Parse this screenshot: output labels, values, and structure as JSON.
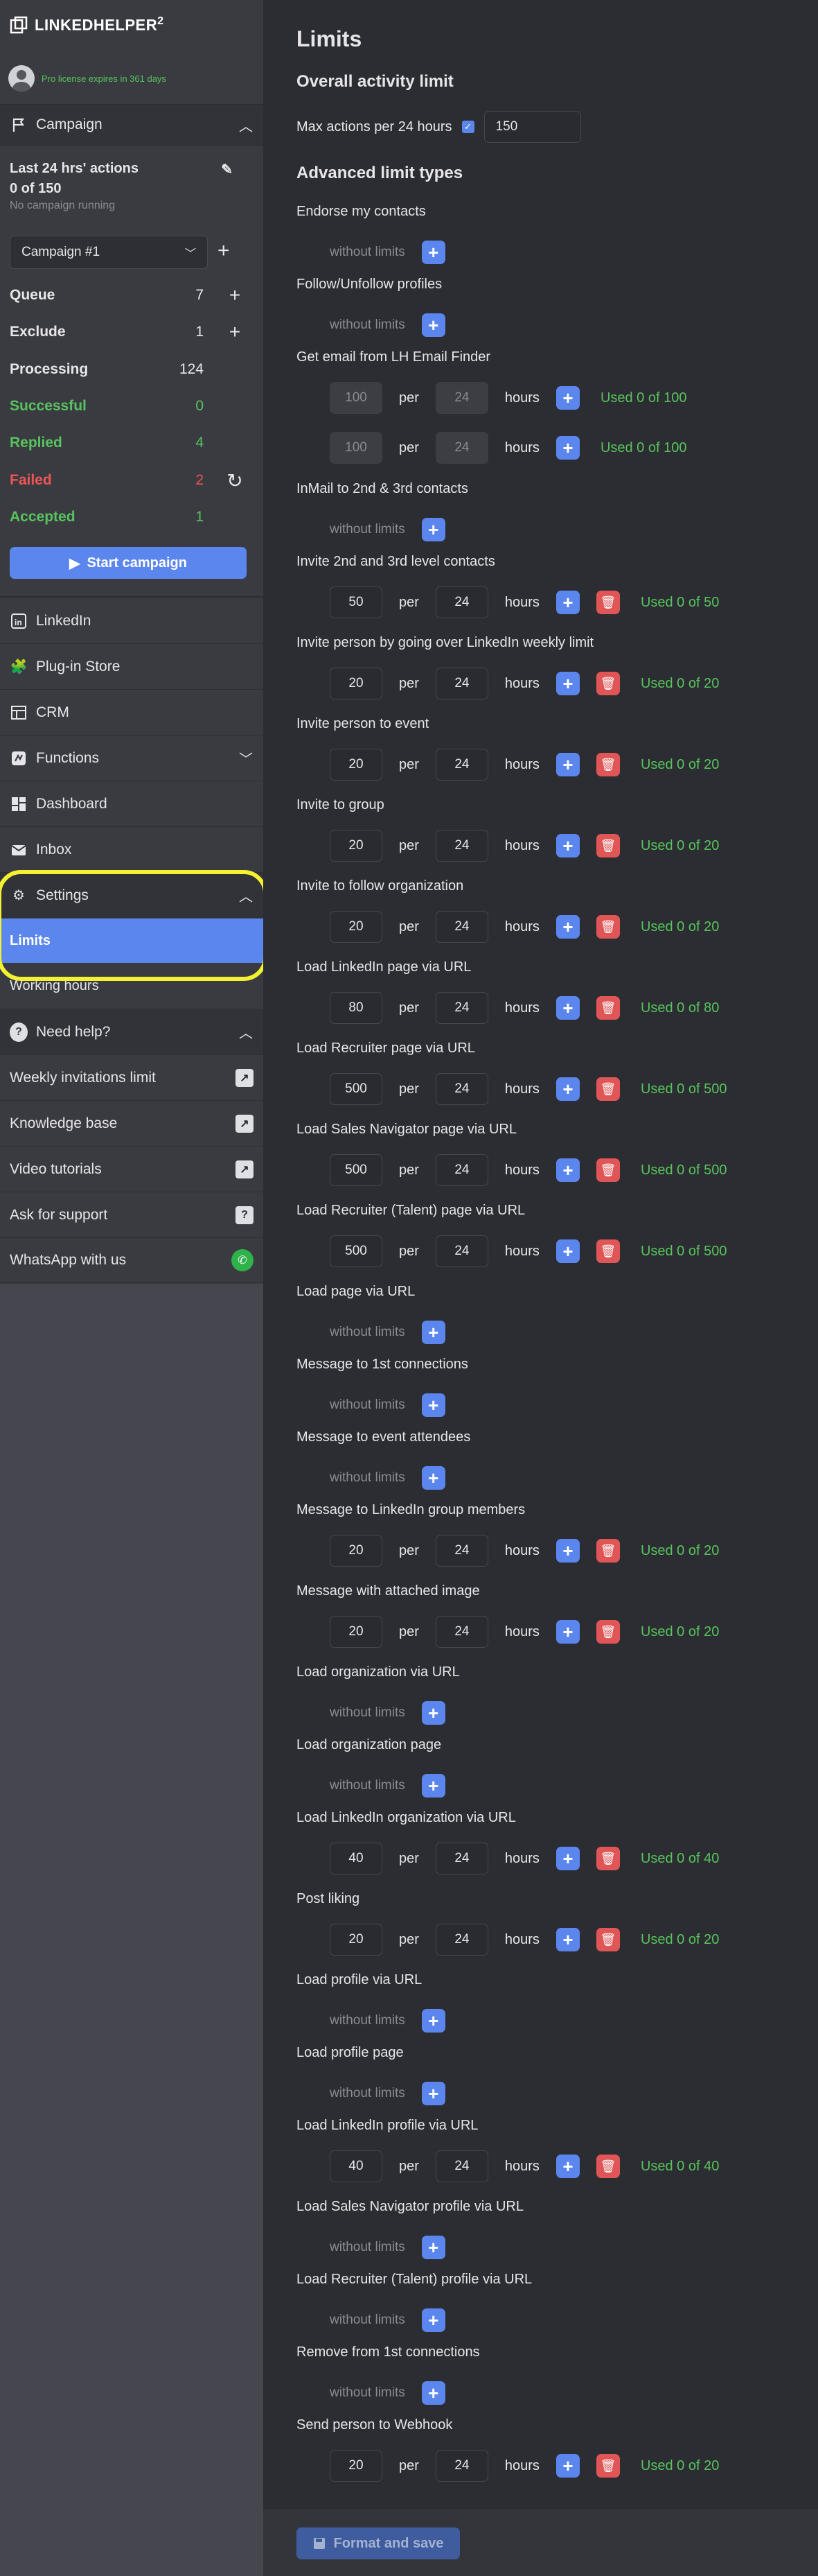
{
  "app": {
    "name": "LINKEDHELPER",
    "version": "2"
  },
  "license": "Pro license expires in 361 days",
  "campaign_section": {
    "title": "Campaign",
    "actions_label": "Last 24 hrs' actions",
    "actions_value": "0 of 150",
    "status": "No campaign running",
    "selected_campaign": "Campaign #1",
    "stats": [
      {
        "label": "Queue",
        "value": "7",
        "action": "+",
        "color": "default"
      },
      {
        "label": "Exclude",
        "value": "1",
        "action": "+",
        "color": "default"
      },
      {
        "label": "Processing",
        "value": "124",
        "action": "",
        "color": "default"
      },
      {
        "label": "Successful",
        "value": "0",
        "action": "",
        "color": "green"
      },
      {
        "label": "Replied",
        "value": "4",
        "action": "",
        "color": "green"
      },
      {
        "label": "Failed",
        "value": "2",
        "action": "↻",
        "color": "red"
      },
      {
        "label": "Accepted",
        "value": "1",
        "action": "",
        "color": "green"
      }
    ],
    "start_button": "Start campaign"
  },
  "nav": {
    "linkedin": "LinkedIn",
    "plugin_store": "Plug-in Store",
    "crm": "CRM",
    "functions": "Functions",
    "dashboard": "Dashboard",
    "inbox": "Inbox",
    "settings": "Settings",
    "limits": "Limits",
    "working_hours": "Working hours",
    "need_help": "Need help?",
    "weekly_limit": "Weekly invitations limit",
    "knowledge_base": "Knowledge base",
    "video_tutorials": "Video tutorials",
    "ask_support": "Ask for support",
    "whatsapp": "WhatsApp with us"
  },
  "main": {
    "title": "Limits",
    "overall_title": "Overall activity limit",
    "max_actions_label": "Max actions per 24 hours",
    "max_actions_value": "150",
    "advanced_title": "Advanced limit types",
    "per_label": "per",
    "hours_label": "hours",
    "without_limits": "without limits",
    "limits": [
      {
        "name": "Endorse my contacts",
        "type": "none"
      },
      {
        "name": "Follow/Unfollow profiles",
        "type": "none"
      },
      {
        "name": "Get email from LH Email Finder",
        "type": "disabled",
        "rows": [
          {
            "count": "100",
            "hours": "24",
            "used": "Used 0 of 100"
          },
          {
            "count": "100",
            "hours": "24",
            "used": "Used 0 of 100"
          }
        ]
      },
      {
        "name": "InMail to 2nd & 3rd contacts",
        "type": "none"
      },
      {
        "name": "Invite 2nd and 3rd level contacts",
        "type": "set",
        "count": "50",
        "hours": "24",
        "used": "Used 0 of 50"
      },
      {
        "name": "Invite person by going over LinkedIn weekly limit",
        "type": "set",
        "count": "20",
        "hours": "24",
        "used": "Used 0 of 20"
      },
      {
        "name": "Invite person to event",
        "type": "set",
        "count": "20",
        "hours": "24",
        "used": "Used 0 of 20"
      },
      {
        "name": "Invite to group",
        "type": "set",
        "count": "20",
        "hours": "24",
        "used": "Used 0 of 20"
      },
      {
        "name": "Invite to follow organization",
        "type": "set",
        "count": "20",
        "hours": "24",
        "used": "Used 0 of 20"
      },
      {
        "name": "Load LinkedIn page via URL",
        "type": "set",
        "count": "80",
        "hours": "24",
        "used": "Used 0 of 80"
      },
      {
        "name": "Load Recruiter page via URL",
        "type": "set",
        "count": "500",
        "hours": "24",
        "used": "Used 0 of 500"
      },
      {
        "name": "Load Sales Navigator page via URL",
        "type": "set",
        "count": "500",
        "hours": "24",
        "used": "Used 0 of 500"
      },
      {
        "name": "Load Recruiter (Talent) page via URL",
        "type": "set",
        "count": "500",
        "hours": "24",
        "used": "Used 0 of 500"
      },
      {
        "name": "Load page via URL",
        "type": "none"
      },
      {
        "name": "Message to 1st connections",
        "type": "none"
      },
      {
        "name": "Message to event attendees",
        "type": "none"
      },
      {
        "name": "Message to LinkedIn group members",
        "type": "set",
        "count": "20",
        "hours": "24",
        "used": "Used 0 of 20"
      },
      {
        "name": "Message with attached image",
        "type": "set",
        "count": "20",
        "hours": "24",
        "used": "Used 0 of 20"
      },
      {
        "name": "Load organization via URL",
        "type": "none"
      },
      {
        "name": "Load organization page",
        "type": "none"
      },
      {
        "name": "Load LinkedIn organization via URL",
        "type": "set",
        "count": "40",
        "hours": "24",
        "used": "Used 0 of 40"
      },
      {
        "name": "Post liking",
        "type": "set",
        "count": "20",
        "hours": "24",
        "used": "Used 0 of 20"
      },
      {
        "name": "Load profile via URL",
        "type": "none"
      },
      {
        "name": "Load profile page",
        "type": "none"
      },
      {
        "name": "Load LinkedIn profile via URL",
        "type": "set",
        "count": "40",
        "hours": "24",
        "used": "Used 0 of 40"
      },
      {
        "name": "Load Sales Navigator profile via URL",
        "type": "none"
      },
      {
        "name": "Load Recruiter (Talent) profile via URL",
        "type": "none"
      },
      {
        "name": "Remove from 1st connections",
        "type": "none"
      },
      {
        "name": "Send person to Webhook",
        "type": "set",
        "count": "20",
        "hours": "24",
        "used": "Used 0 of 20"
      }
    ],
    "save_button": "Format and save"
  }
}
